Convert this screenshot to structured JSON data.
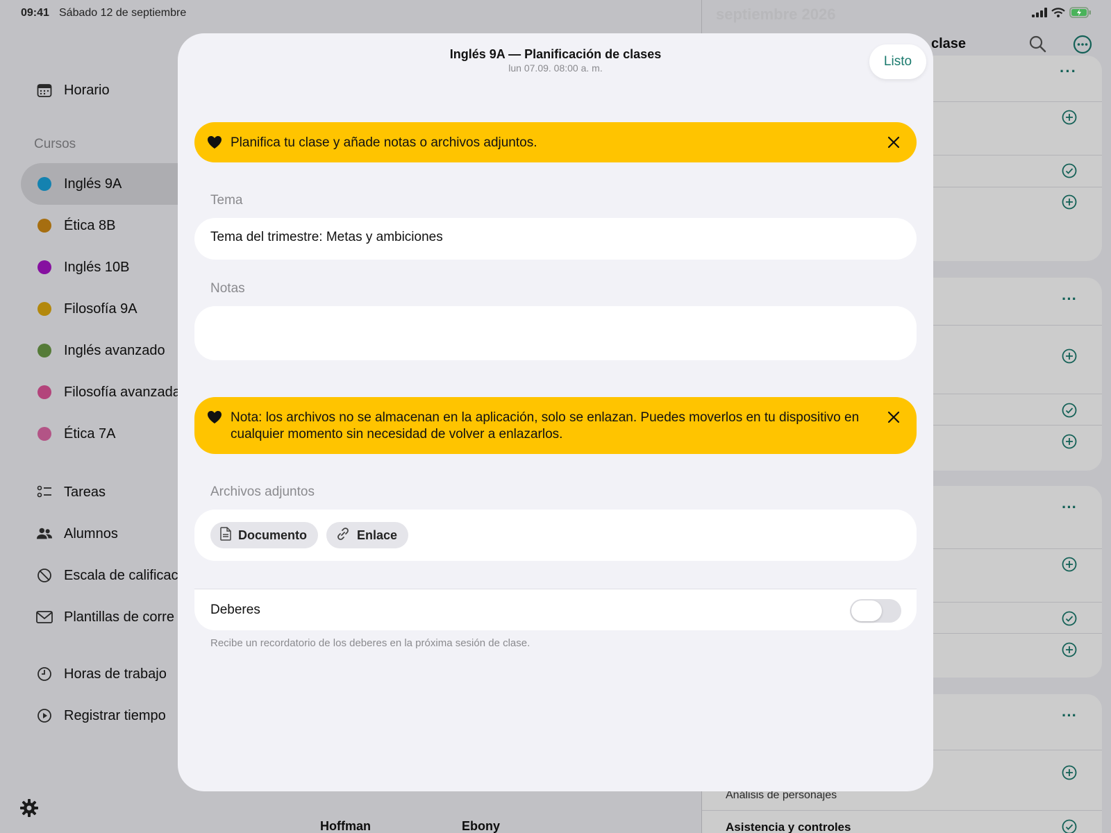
{
  "status": {
    "time": "09:41",
    "date": "Sábado 12 de septiembre"
  },
  "sidebar": {
    "schedule_label": "Horario",
    "courses_label": "Cursos",
    "courses": [
      {
        "label": "Inglés 9A",
        "color": "#1aa3dc"
      },
      {
        "label": "Ética 8B",
        "color": "#d08a14"
      },
      {
        "label": "Inglés 10B",
        "color": "#a814c8"
      },
      {
        "label": "Filosofía 9A",
        "color": "#e0aa10"
      },
      {
        "label": "Inglés avanzado",
        "color": "#6b9a46"
      },
      {
        "label": "Filosofía avanzada",
        "color": "#e0559a"
      },
      {
        "label": "Ética 7A",
        "color": "#e06aa8"
      }
    ],
    "tools": [
      {
        "label": "Tareas",
        "icon": "checklist-icon"
      },
      {
        "label": "Alumnos",
        "icon": "people-icon"
      },
      {
        "label": "Escala de calificac",
        "icon": "grading-scale-icon"
      },
      {
        "label": "Plantillas de corre",
        "icon": "envelope-icon"
      }
    ],
    "time_items": [
      {
        "label": "Horas de trabajo",
        "icon": "clock-icon"
      },
      {
        "label": "Registrar tiempo",
        "icon": "play-circle-icon"
      }
    ]
  },
  "right_panel": {
    "month_title": "septiembre 2026",
    "header_fragment": "clase",
    "row_texts": [
      "Análisis de personajes",
      "Asistencia y controles"
    ],
    "bottom_names": [
      "Hoffman",
      "Ebony"
    ]
  },
  "modal": {
    "title": "Inglés 9A — Planificación de clases",
    "subtitle": "lun 07.09. 08:00 a. m.",
    "done_label": "Listo",
    "banner1": "Planifica tu clase y añade notas o archivos adjuntos.",
    "topic_label": "Tema",
    "topic_value": "Tema del trimestre: Metas y ambiciones",
    "notes_label": "Notas",
    "notes_value": "",
    "banner2": "Nota: los archivos no se almacenan en la aplicación, solo se enlazan. Puedes moverlos en tu dispositivo en cualquier momento sin necesidad de volver a enlazarlos.",
    "attachments_label": "Archivos adjuntos",
    "document_label": "Documento",
    "link_label": "Enlace",
    "homework_label": "Deberes",
    "homework_enabled": false,
    "homework_hint": "Recibe un recordatorio de los deberes en la próxima sesión de clase."
  },
  "colors": {
    "accent": "#1a7a6d",
    "banner": "#ffc400"
  }
}
